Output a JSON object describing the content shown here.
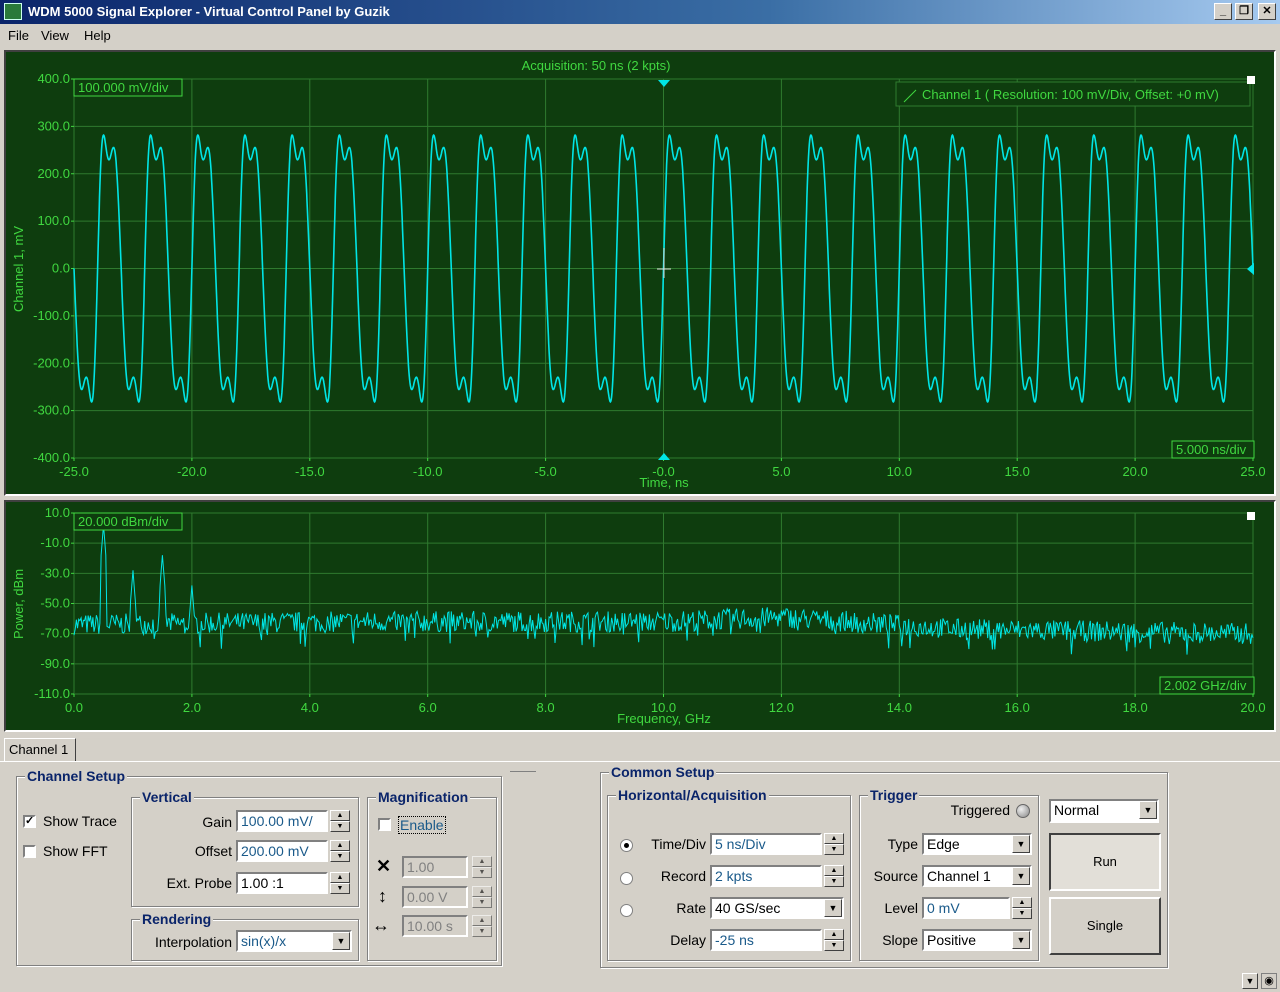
{
  "window": {
    "title": "WDM 5000 Signal Explorer - Virtual Control Panel by Guzik",
    "controls": [
      "_",
      "❐",
      "✕"
    ]
  },
  "menu": [
    "File",
    "View",
    "Help"
  ],
  "time_scope": {
    "acquisition_label": "Acquisition: 50 ns (2 kpts)",
    "vdiv_badge": "100.000 mV/div",
    "hdiv_badge": "5.000 ns/div",
    "legend": "Channel 1 ( Resolution: 100 mV/Div, Offset:  +0 mV)",
    "ylabel": "Channel 1, mV",
    "xlabel": "Time, ns",
    "yticks": [
      "400.0",
      "300.0",
      "200.0",
      "100.0",
      "0.0",
      "-100.0",
      "-200.0",
      "-300.0",
      "-400.0"
    ],
    "xticks": [
      "-25.0",
      "-20.0",
      "-15.0",
      "-10.0",
      "-5.0",
      "-0.0",
      "5.0",
      "10.0",
      "15.0",
      "20.0",
      "25.0"
    ]
  },
  "fft_scope": {
    "vdiv_badge": "20.000 dBm/div",
    "hdiv_badge": "2.002 GHz/div",
    "ylabel": "Power, dBm",
    "xlabel": "Frequency, GHz",
    "yticks": [
      "10.0",
      "-10.0",
      "-30.0",
      "-50.0",
      "-70.0",
      "-90.0",
      "-110.0"
    ],
    "xticks": [
      "0.0",
      "2.0",
      "4.0",
      "6.0",
      "8.0",
      "10.0",
      "12.0",
      "14.0",
      "16.0",
      "18.0",
      "20.0"
    ]
  },
  "chart_data": [
    {
      "type": "line",
      "xlabel": "Time, ns",
      "ylabel": "Channel 1, mV",
      "xlim": [
        -25,
        25
      ],
      "ylim": [
        -400,
        400
      ],
      "grid": true,
      "series": [
        {
          "name": "Channel 1",
          "color": "#00e5e5",
          "signal_components": [
            {
              "frequency_ghz": 0.5,
              "amplitude_mv": 300
            },
            {
              "frequency_ghz": 1.5,
              "amplitude_mv": 70
            },
            {
              "frequency_ghz": 1.0,
              "amplitude_mv": 20
            },
            {
              "frequency_ghz": 2.0,
              "amplitude_mv": 15
            }
          ]
        }
      ]
    },
    {
      "type": "line",
      "xlabel": "Frequency, GHz",
      "ylabel": "Power, dBm",
      "xlim": [
        0,
        20
      ],
      "ylim": [
        -110,
        10
      ],
      "grid": true,
      "series": [
        {
          "name": "FFT",
          "color": "#00e5e5",
          "peaks": [
            {
              "x": 0.5,
              "y": 2
            },
            {
              "x": 1.0,
              "y": -28
            },
            {
              "x": 1.5,
              "y": -18
            },
            {
              "x": 2.0,
              "y": -38
            }
          ],
          "noise_floor": [
            {
              "x": 0.0,
              "y": -64
            },
            {
              "x": 5.0,
              "y": -62
            },
            {
              "x": 10.0,
              "y": -62
            },
            {
              "x": 12.0,
              "y": -59
            },
            {
              "x": 15.0,
              "y": -67
            },
            {
              "x": 20.0,
              "y": -70
            }
          ]
        }
      ]
    }
  ],
  "tabs": [
    "Channel 1"
  ],
  "channel_setup": {
    "title": "Channel Setup",
    "show_trace": {
      "label": "Show Trace",
      "checked": true
    },
    "show_fft": {
      "label": "Show FFT",
      "checked": false
    },
    "vertical": {
      "title": "Vertical",
      "gain_label": "Gain",
      "gain_value": "100.00 mV/",
      "offset_label": "Offset",
      "offset_value": "200.00 mV",
      "probe_label": "Ext. Probe",
      "probe_value": "1.00 :1"
    },
    "rendering": {
      "title": "Rendering",
      "interp_label": "Interpolation",
      "interp_value": "sin(x)/x"
    },
    "magnification": {
      "title": "Magnification",
      "enable_label": "Enable",
      "enabled": false,
      "x_value": "1.00",
      "v_value": "0.00 V",
      "t_value": "10.00 s"
    }
  },
  "common_setup": {
    "title": "Common Setup",
    "horizontal": {
      "title": "Horizontal/Acquisition",
      "timediv_label": "Time/Div",
      "timediv_value": "5 ns/Div",
      "record_label": "Record",
      "record_value": "2 kpts",
      "rate_label": "Rate",
      "rate_value": "40 GS/sec",
      "delay_label": "Delay",
      "delay_value": "-25 ns"
    },
    "trigger": {
      "title": "Trigger",
      "triggered_label": "Triggered",
      "type_label": "Type",
      "type_value": "Edge",
      "source_label": "Source",
      "source_value": "Channel 1",
      "level_label": "Level",
      "level_value": "0 mV",
      "slope_label": "Slope",
      "slope_value": "Positive"
    },
    "mode_value": "Normal",
    "run_label": "Run",
    "single_label": "Single"
  }
}
